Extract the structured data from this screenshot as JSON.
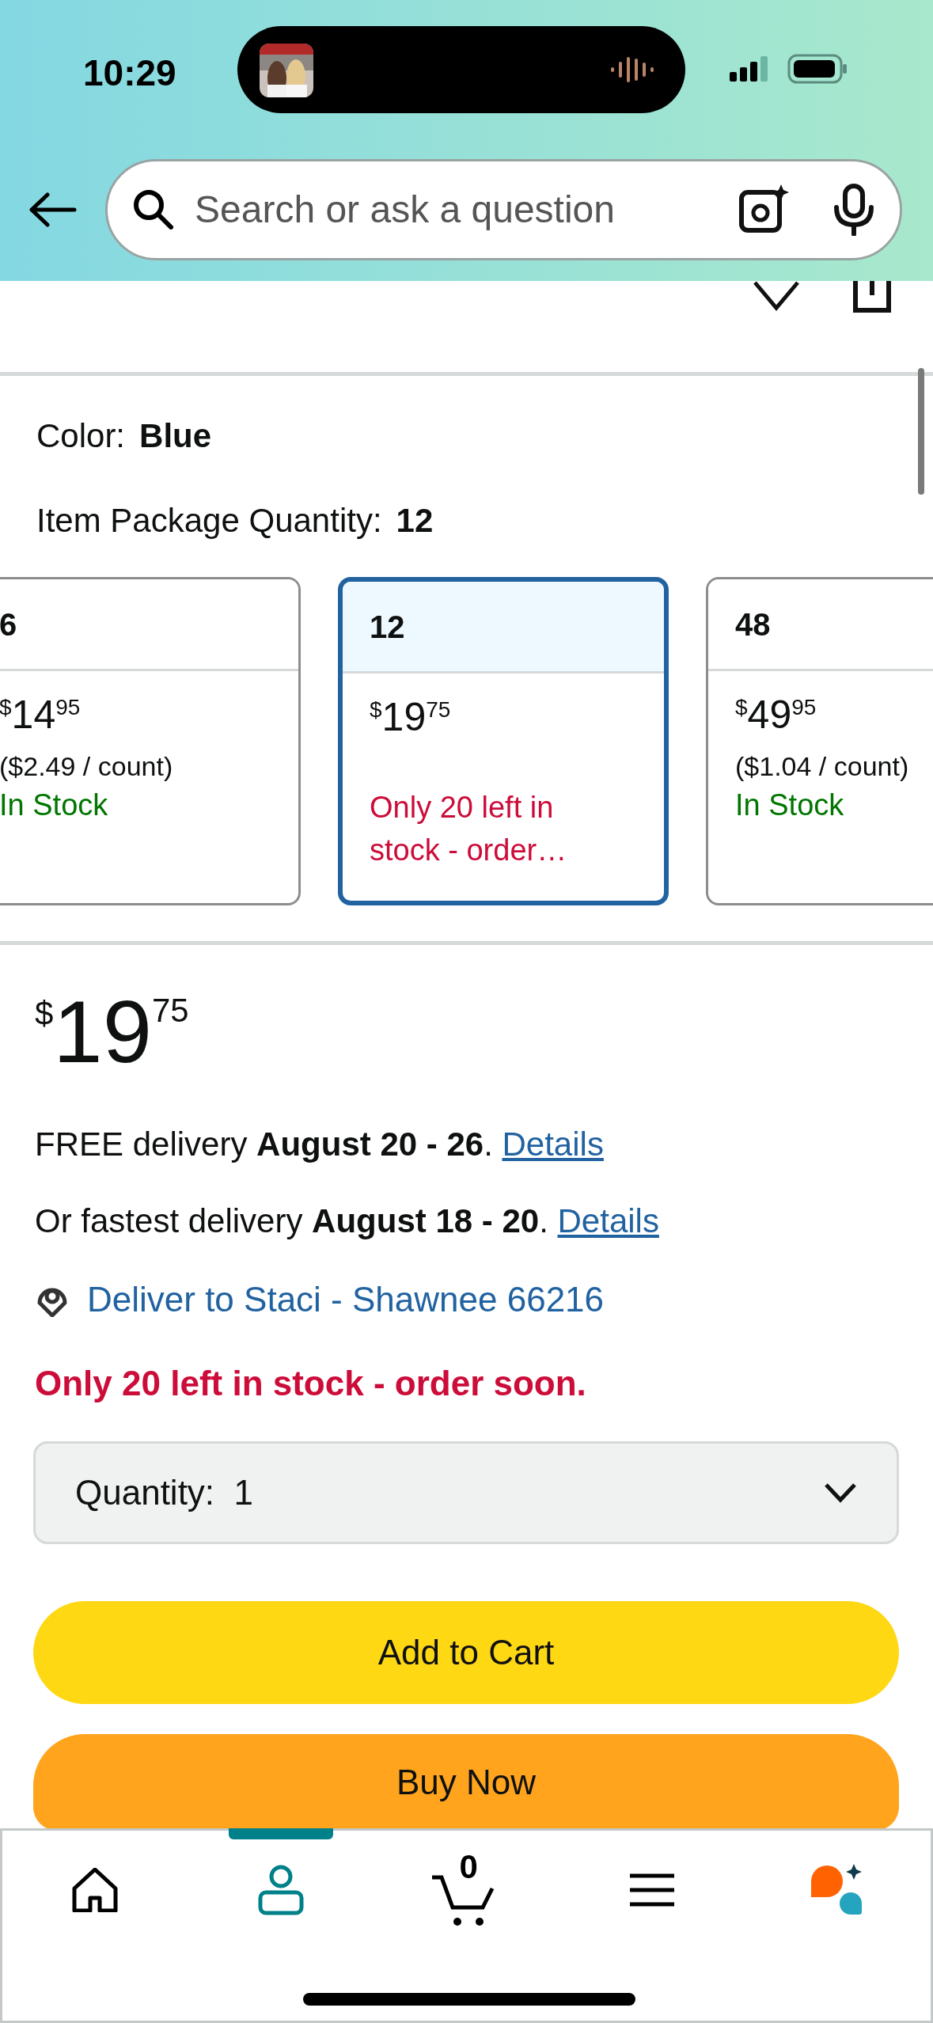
{
  "status_bar": {
    "time": "10:29"
  },
  "search": {
    "placeholder": "Search or ask a question"
  },
  "color": {
    "label": "Color:",
    "value": "Blue"
  },
  "package_quantity": {
    "label": "Item Package Quantity:",
    "value": "12"
  },
  "options": [
    {
      "count": "6",
      "currency": "$",
      "whole": "14",
      "fraction": "95",
      "unit_price": "($2.49 / count)",
      "availability": "In Stock",
      "low_stock": false,
      "selected": false
    },
    {
      "count": "12",
      "currency": "$",
      "whole": "19",
      "fraction": "75",
      "availability": "Only 20 left in stock - order…",
      "low_stock": true,
      "selected": true
    },
    {
      "count": "48",
      "currency": "$",
      "whole": "49",
      "fraction": "95",
      "unit_price": "($1.04 / count)",
      "availability": "In Stock",
      "low_stock": false,
      "selected": false
    }
  ],
  "price": {
    "currency": "$",
    "whole": "19",
    "fraction": "75"
  },
  "delivery": [
    {
      "text": "FREE delivery **August 20 - 26**.",
      "link": "Details"
    },
    {
      "text": "Or fastest delivery **August 18 - 20**.",
      "link": "Details"
    }
  ],
  "deliver_to": "Deliver to Staci - Shawnee 66216",
  "stock_notice": "Only 20 left in stock - order soon.",
  "quantity_select": {
    "value": "Quantity:  1"
  },
  "buttons": [
    {
      "label": "Add to Cart",
      "kind": "add_to_cart"
    },
    {
      "label": "Buy Now",
      "kind": "buy_now"
    }
  ],
  "nav": [
    {
      "kind": "home",
      "selected": false
    },
    {
      "kind": "account",
      "selected": true
    },
    {
      "kind": "cart",
      "badge": "0",
      "selected": false
    },
    {
      "kind": "menu",
      "selected": false
    },
    {
      "kind": "assistant",
      "selected": false
    }
  ]
}
